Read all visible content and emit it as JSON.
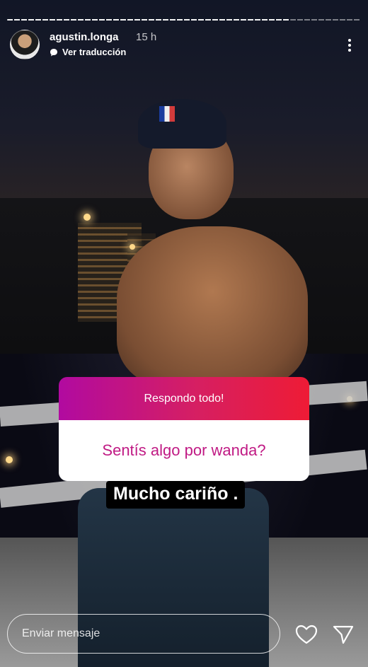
{
  "story": {
    "progress": {
      "segments_total": 2,
      "current_segment": 1
    },
    "user": {
      "username": "agustin.longa",
      "time_ago": "15 h",
      "translate_label": "Ver traducción"
    },
    "question_sticker": {
      "header": "Respondo todo!",
      "question": "Sentís algo por wanda?",
      "colors": {
        "gradient_start": "#b10aa0",
        "gradient_end": "#ee1b35",
        "question_text": "#c01a84"
      }
    },
    "answer_text": "Mucho cariño ."
  },
  "footer": {
    "message_placeholder": "Enviar mensaje"
  },
  "icons": {
    "more": "more-options-icon",
    "translate": "chat-bubble-icon",
    "like": "heart-icon",
    "send": "paper-plane-icon"
  }
}
